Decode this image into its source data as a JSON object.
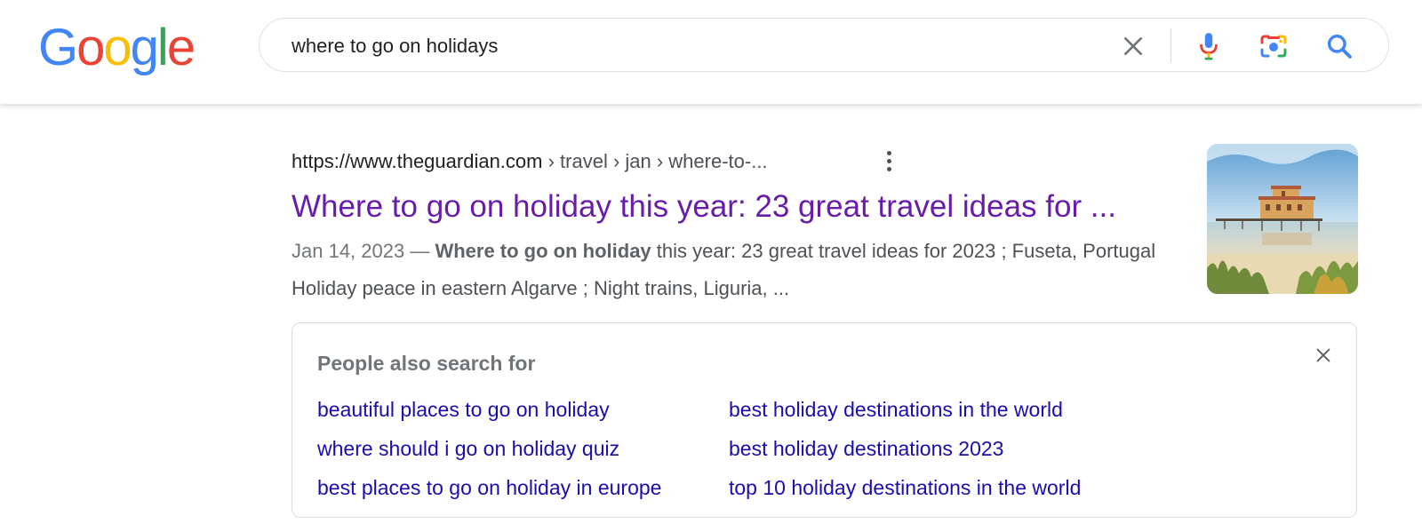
{
  "logo": {
    "text": "Google",
    "letters": [
      {
        "ch": "G",
        "color": "#4285F4"
      },
      {
        "ch": "o",
        "color": "#EA4335"
      },
      {
        "ch": "o",
        "color": "#FBBC05"
      },
      {
        "ch": "g",
        "color": "#4285F4"
      },
      {
        "ch": "l",
        "color": "#34A853"
      },
      {
        "ch": "e",
        "color": "#EA4335"
      }
    ]
  },
  "search": {
    "query": "where to go on holidays",
    "icons": [
      "close-icon",
      "microphone-icon",
      "camera-lens-icon",
      "search-icon"
    ]
  },
  "result": {
    "url_domain": "https://www.theguardian.com",
    "url_path": " › travel › jan › where-to-...",
    "title": "Where to go on holiday this year: 23 great travel ideas for ...",
    "date": "Jan 14, 2023 — ",
    "snippet_bold": "Where to go on holiday",
    "snippet_rest": " this year: 23 great travel ideas for 2023 ; Fuseta, Portugal Holiday peace in eastern Algarve ; Night trains, Liguria, ...",
    "thumbnail": "beach-pier-building-image",
    "title_color": "#681da8"
  },
  "pasf": {
    "title": "People also search for",
    "links": [
      "beautiful places to go on holiday",
      "where should i go on holiday quiz",
      "best places to go on holiday in europe",
      "best holiday destinations in the world",
      "best holiday destinations 2023",
      "top 10 holiday destinations in the world"
    ],
    "link_color": "#1a0dab"
  }
}
